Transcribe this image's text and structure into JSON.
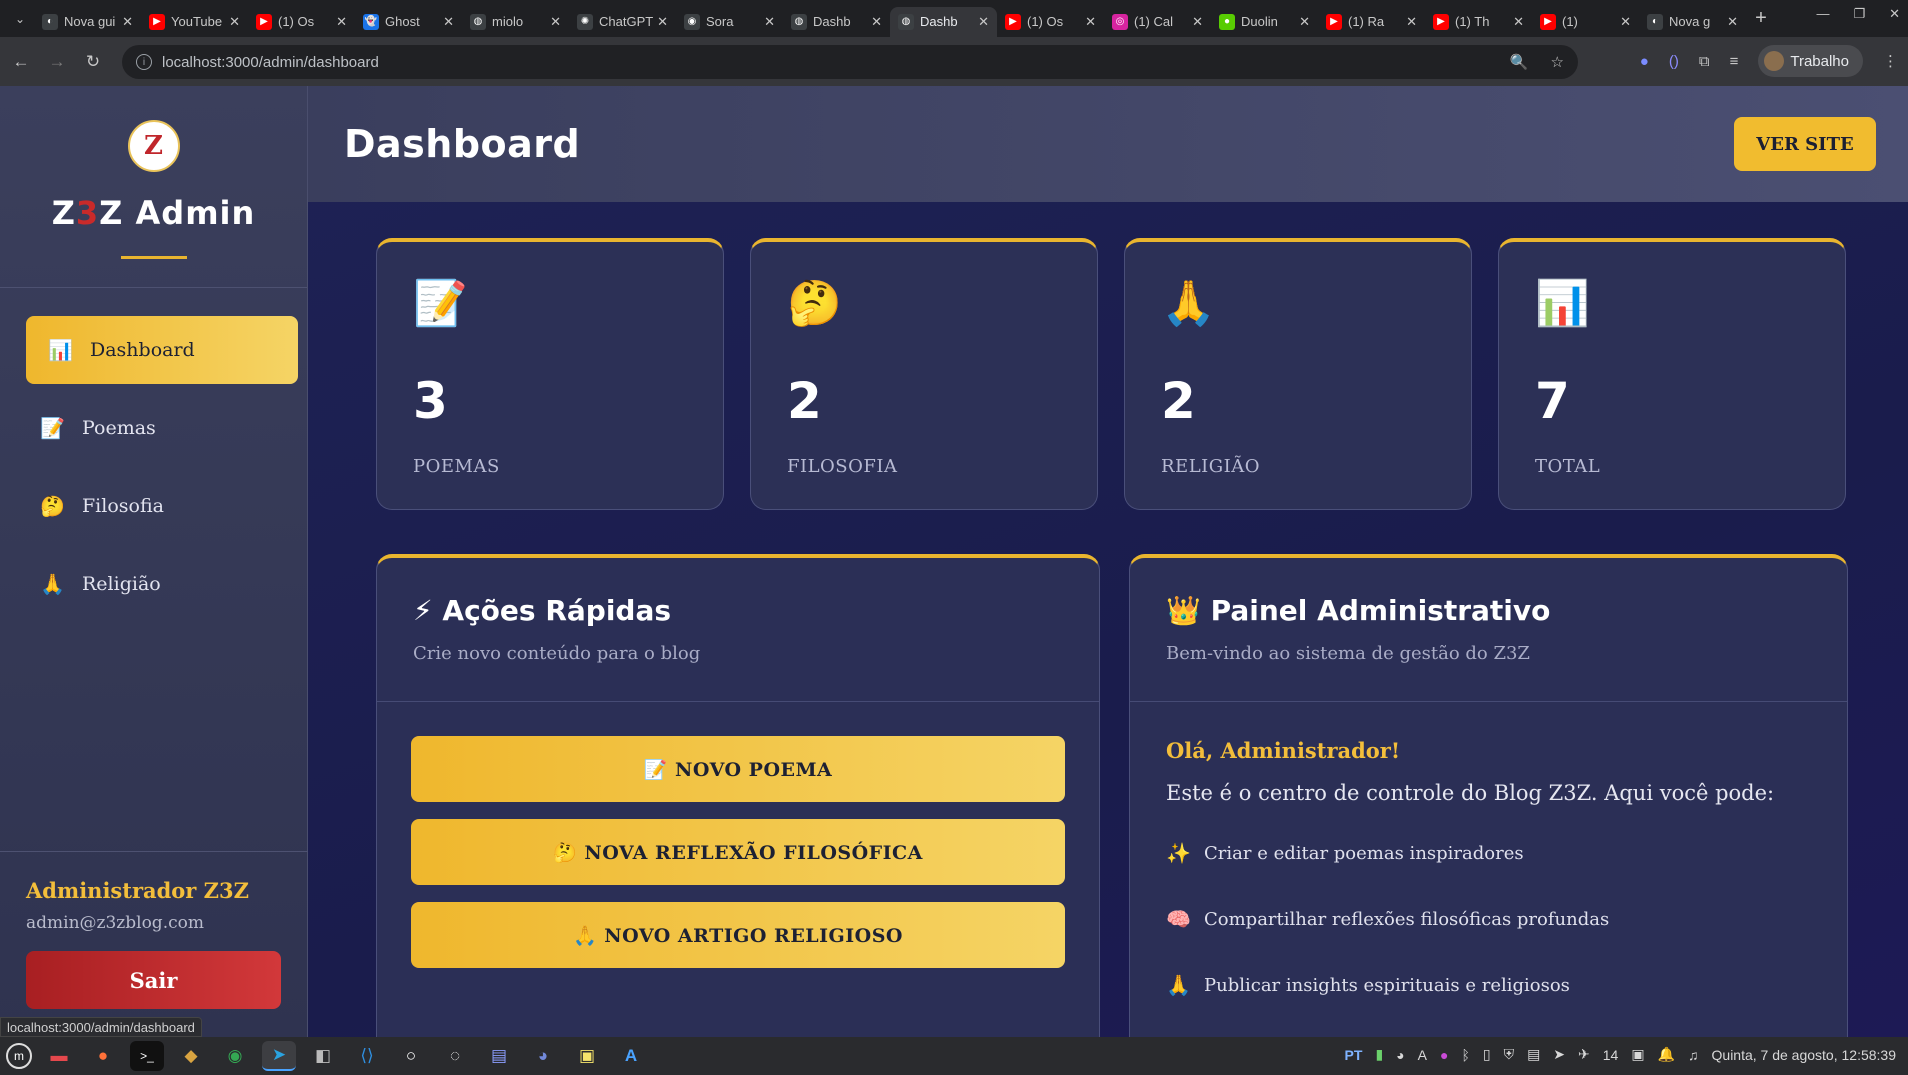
{
  "browser": {
    "tabs": [
      {
        "label": "Nova gui",
        "fav_color": "#3c4043",
        "fav_glyph": "◐"
      },
      {
        "label": "YouTube",
        "fav_color": "#ff0000",
        "fav_glyph": "▶"
      },
      {
        "label": "(1) Os",
        "fav_color": "#ff0000",
        "fav_glyph": "▶"
      },
      {
        "label": "Ghost",
        "fav_color": "#1a73e8",
        "fav_glyph": "👻"
      },
      {
        "label": "miolo",
        "fav_color": "#3c4043",
        "fav_glyph": "◍"
      },
      {
        "label": "ChatGPT",
        "fav_color": "#3c4043",
        "fav_glyph": "✺"
      },
      {
        "label": "Sora",
        "fav_color": "#3c4043",
        "fav_glyph": "◉"
      },
      {
        "label": "Dashb",
        "fav_color": "#3c4043",
        "fav_glyph": "◍"
      },
      {
        "label": "Dashb",
        "fav_color": "#3c4043",
        "fav_glyph": "◍"
      },
      {
        "label": "(1) Os",
        "fav_color": "#ff0000",
        "fav_glyph": "▶"
      },
      {
        "label": "(1) Cal",
        "fav_color": "#d6249f",
        "fav_glyph": "◎"
      },
      {
        "label": "Duolin",
        "fav_color": "#58cc02",
        "fav_glyph": "●"
      },
      {
        "label": "(1) Ra",
        "fav_color": "#ff0000",
        "fav_glyph": "▶"
      },
      {
        "label": "(1) Th",
        "fav_color": "#ff0000",
        "fav_glyph": "▶"
      },
      {
        "label": "(1)",
        "fav_color": "#ff0000",
        "fav_glyph": "▶"
      },
      {
        "label": "Nova g",
        "fav_color": "#3c4043",
        "fav_glyph": "◐"
      }
    ],
    "active_tab_index": 8,
    "url": "localhost:3000/admin/dashboard",
    "profile_label": "Trabalho",
    "status_url": "localhost:3000/admin/dashboard"
  },
  "sidebar": {
    "logo_letter": "Z",
    "brand": {
      "part1": "Z",
      "part2": "3",
      "part3": "Z Admin"
    },
    "items": [
      {
        "label": "Dashboard",
        "icon": "📊",
        "icon_name": "bar-chart-icon"
      },
      {
        "label": "Poemas",
        "icon": "📝",
        "icon_name": "memo-icon"
      },
      {
        "label": "Filosofia",
        "icon": "🤔",
        "icon_name": "thinking-face-icon"
      },
      {
        "label": "Religião",
        "icon": "🙏",
        "icon_name": "praying-hands-icon"
      }
    ],
    "user": {
      "name": "Administrador Z3Z",
      "email": "admin@z3zblog.com"
    },
    "logout_label": "Sair"
  },
  "header": {
    "title": "Dashboard",
    "view_site_label": "VER SITE"
  },
  "stats": [
    {
      "icon": "📝",
      "value": "3",
      "label": "POEMAS"
    },
    {
      "icon": "🤔",
      "value": "2",
      "label": "FILOSOFIA"
    },
    {
      "icon": "🙏",
      "value": "2",
      "label": "RELIGIÃO"
    },
    {
      "icon": "📊",
      "value": "7",
      "label": "TOTAL"
    }
  ],
  "quick_actions": {
    "title": "⚡ Ações Rápidas",
    "subtitle": "Crie novo conteúdo para o blog",
    "buttons": [
      {
        "label": "📝 NOVO POEMA"
      },
      {
        "label": "🤔 NOVA REFLEXÃO FILOSÓFICA"
      },
      {
        "label": "🙏 NOVO ARTIGO RELIGIOSO"
      }
    ]
  },
  "admin_panel": {
    "title": "👑 Painel Administrativo",
    "subtitle": "Bem-vindo ao sistema de gestão do Z3Z",
    "greeting": "Olá, Administrador!",
    "intro": "Este é o centro de controle do Blog Z3Z. Aqui você pode:",
    "features": [
      {
        "icon": "✨",
        "text": "Criar e editar poemas inspiradores"
      },
      {
        "icon": "🧠",
        "text": "Compartilhar reflexões filosóficas profundas"
      },
      {
        "icon": "🙏",
        "text": "Publicar insights espirituais e religiosos"
      }
    ]
  },
  "taskbar": {
    "lang": "PT",
    "tray_count": "14",
    "datetime": "Quinta, 7 de agosto, 12:58:39"
  },
  "colors": {
    "accent": "#f1bc2f",
    "danger": "#c92a2a",
    "sidebar_bg": "#3b3f5c",
    "main_bg": "#1e2255"
  }
}
